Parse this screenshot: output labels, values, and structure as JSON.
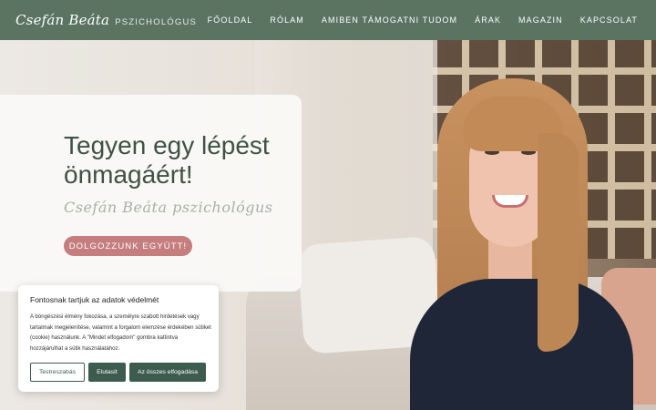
{
  "header": {
    "logo_script": "Csefán Beáta",
    "logo_sub": "PSZICHOLÓGUS",
    "nav": [
      "FŐOLDAL",
      "RÓLAM",
      "AMIBEN TÁMOGATNI TUDOM",
      "ÁRAK",
      "MAGAZIN",
      "KAPCSOLAT"
    ]
  },
  "hero": {
    "headline": "Tegyen egy lépést önmagáért!",
    "script": "Csefán Beáta pszichológus",
    "cta": "DOLGOZZUNK EGYÜTT!"
  },
  "cookie": {
    "title": "Fontosnak tartjuk az adatok védelmét",
    "text": "A böngészési élmény fokozása, a személyre szabott hirdetések vagy tartalmak megjelenítése, valamint a forgalom elemzése érdekében sütiket (cookie) használunk. A \"Mindet elfogadom\" gombra kattintva hozzájárulhat a sütik használatához.",
    "customize": "Testreszabás",
    "reject": "Elutasít",
    "accept": "Az összes elfogadása"
  },
  "colors": {
    "header_bg": "#5b7462",
    "headline": "#3f5244",
    "cta_bg": "#c57d7e",
    "cookie_button": "#3d5c50"
  }
}
